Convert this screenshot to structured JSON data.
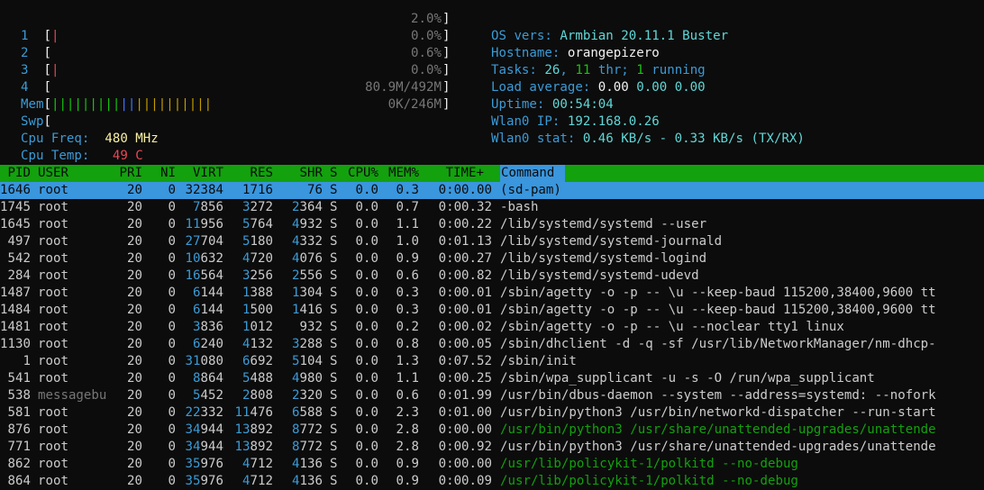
{
  "meters": {
    "cpus": [
      {
        "label": "1",
        "value": "2.0%"
      },
      {
        "label": "2",
        "value": "0.0%"
      },
      {
        "label": "3",
        "value": "0.6%"
      },
      {
        "label": "4",
        "value": "0.0%"
      }
    ],
    "mem": {
      "label": "Mem",
      "value": "80.9M/492M"
    },
    "swp": {
      "label": "Swp",
      "value": "0K/246M"
    },
    "cpu_freq": {
      "label": "Cpu Freq:",
      "value": "480 MHz"
    },
    "cpu_temp": {
      "label": "Cpu Temp:",
      "value": "49 C"
    }
  },
  "sysinfo": {
    "os_label": "OS vers:",
    "os_value": "Armbian 20.11.1 Buster",
    "host_label": "Hostname:",
    "host_value": "orangepizero",
    "tasks_label": "Tasks:",
    "tasks_count": "26",
    "tasks_sep1": ", ",
    "tasks_thr": "11",
    "tasks_thr_label": " thr; ",
    "tasks_running": "1",
    "tasks_running_label": " running",
    "load_label": "Load average:",
    "load1": "0.00",
    "load5": "0.00",
    "load15": "0.00",
    "uptime_label": "Uptime:",
    "uptime_value": "00:54:04",
    "ip_label": "Wlan0 IP:",
    "ip_value": "192.168.0.26",
    "stat_label": "Wlan0 stat:",
    "stat_value": "0.46 KB/s - 0.33 KB/s (TX/RX)"
  },
  "columns": [
    "PID",
    "USER",
    "PRI",
    "NI",
    "VIRT",
    "RES",
    "SHR",
    "S",
    "CPU%",
    "MEM%",
    "TIME+",
    "Command"
  ],
  "processes": [
    {
      "pid": "1646",
      "user": "root",
      "pri": "20",
      "ni": "0",
      "virt": "32384",
      "res": "1716",
      "shr": "76",
      "s": "S",
      "cpu": "0.0",
      "mem": "0.3",
      "time": "0:00.00",
      "cmd": "(sd-pam)"
    },
    {
      "pid": "1745",
      "user": "root",
      "pri": "20",
      "ni": "0",
      "virt": "7856",
      "res": "3272",
      "shr": "2364",
      "s": "S",
      "cpu": "0.0",
      "mem": "0.7",
      "time": "0:00.32",
      "cmd": "-bash"
    },
    {
      "pid": "1645",
      "user": "root",
      "pri": "20",
      "ni": "0",
      "virt": "11956",
      "res": "5764",
      "shr": "4932",
      "s": "S",
      "cpu": "0.0",
      "mem": "1.1",
      "time": "0:00.22",
      "cmd": "/lib/systemd/systemd --user"
    },
    {
      "pid": "497",
      "user": "root",
      "pri": "20",
      "ni": "0",
      "virt": "27704",
      "res": "5180",
      "shr": "4332",
      "s": "S",
      "cpu": "0.0",
      "mem": "1.0",
      "time": "0:01.13",
      "cmd": "/lib/systemd/systemd-journald"
    },
    {
      "pid": "542",
      "user": "root",
      "pri": "20",
      "ni": "0",
      "virt": "10632",
      "res": "4720",
      "shr": "4076",
      "s": "S",
      "cpu": "0.0",
      "mem": "0.9",
      "time": "0:00.27",
      "cmd": "/lib/systemd/systemd-logind"
    },
    {
      "pid": "284",
      "user": "root",
      "pri": "20",
      "ni": "0",
      "virt": "16564",
      "res": "3256",
      "shr": "2556",
      "s": "S",
      "cpu": "0.0",
      "mem": "0.6",
      "time": "0:00.82",
      "cmd": "/lib/systemd/systemd-udevd"
    },
    {
      "pid": "1487",
      "user": "root",
      "pri": "20",
      "ni": "0",
      "virt": "6144",
      "res": "1388",
      "shr": "1304",
      "s": "S",
      "cpu": "0.0",
      "mem": "0.3",
      "time": "0:00.01",
      "cmd": "/sbin/agetty -o -p -- \\u --keep-baud 115200,38400,9600 tt"
    },
    {
      "pid": "1484",
      "user": "root",
      "pri": "20",
      "ni": "0",
      "virt": "6144",
      "res": "1500",
      "shr": "1416",
      "s": "S",
      "cpu": "0.0",
      "mem": "0.3",
      "time": "0:00.01",
      "cmd": "/sbin/agetty -o -p -- \\u --keep-baud 115200,38400,9600 tt"
    },
    {
      "pid": "1481",
      "user": "root",
      "pri": "20",
      "ni": "0",
      "virt": "3836",
      "res": "1012",
      "shr": "932",
      "s": "S",
      "cpu": "0.0",
      "mem": "0.2",
      "time": "0:00.02",
      "cmd": "/sbin/agetty -o -p -- \\u --noclear tty1 linux"
    },
    {
      "pid": "1130",
      "user": "root",
      "pri": "20",
      "ni": "0",
      "virt": "6240",
      "res": "4132",
      "shr": "3288",
      "s": "S",
      "cpu": "0.0",
      "mem": "0.8",
      "time": "0:00.05",
      "cmd": "/sbin/dhclient -d -q -sf /usr/lib/NetworkManager/nm-dhcp-"
    },
    {
      "pid": "1",
      "user": "root",
      "pri": "20",
      "ni": "0",
      "virt": "31080",
      "res": "6692",
      "shr": "5104",
      "s": "S",
      "cpu": "0.0",
      "mem": "1.3",
      "time": "0:07.52",
      "cmd": "/sbin/init"
    },
    {
      "pid": "541",
      "user": "root",
      "pri": "20",
      "ni": "0",
      "virt": "8864",
      "res": "5488",
      "shr": "4980",
      "s": "S",
      "cpu": "0.0",
      "mem": "1.1",
      "time": "0:00.25",
      "cmd": "/sbin/wpa_supplicant -u -s -O /run/wpa_supplicant"
    },
    {
      "pid": "538",
      "user": "messagebu",
      "pri": "20",
      "ni": "0",
      "virt": "5452",
      "res": "2808",
      "shr": "2320",
      "s": "S",
      "cpu": "0.0",
      "mem": "0.6",
      "time": "0:01.99",
      "cmd": "/usr/bin/dbus-daemon --system --address=systemd: --nofork"
    },
    {
      "pid": "581",
      "user": "root",
      "pri": "20",
      "ni": "0",
      "virt": "22332",
      "res": "11476",
      "shr": "6588",
      "s": "S",
      "cpu": "0.0",
      "mem": "2.3",
      "time": "0:01.00",
      "cmd": "/usr/bin/python3 /usr/bin/networkd-dispatcher --run-start"
    },
    {
      "pid": "876",
      "user": "root",
      "pri": "20",
      "ni": "0",
      "virt": "34944",
      "res": "13892",
      "shr": "8772",
      "s": "S",
      "cpu": "0.0",
      "mem": "2.8",
      "time": "0:00.00",
      "cmd": "/usr/bin/python3 /usr/share/unattended-upgrades/unattende",
      "thread": true
    },
    {
      "pid": "771",
      "user": "root",
      "pri": "20",
      "ni": "0",
      "virt": "34944",
      "res": "13892",
      "shr": "8772",
      "s": "S",
      "cpu": "0.0",
      "mem": "2.8",
      "time": "0:00.92",
      "cmd": "/usr/bin/python3 /usr/share/unattended-upgrades/unattende"
    },
    {
      "pid": "862",
      "user": "root",
      "pri": "20",
      "ni": "0",
      "virt": "35976",
      "res": "4712",
      "shr": "4136",
      "s": "S",
      "cpu": "0.0",
      "mem": "0.9",
      "time": "0:00.00",
      "cmd": "/usr/lib/policykit-1/polkitd --no-debug",
      "thread": true
    },
    {
      "pid": "864",
      "user": "root",
      "pri": "20",
      "ni": "0",
      "virt": "35976",
      "res": "4712",
      "shr": "4136",
      "s": "S",
      "cpu": "0.0",
      "mem": "0.9",
      "time": "0:00.09",
      "cmd": "/usr/lib/policykit-1/polkitd --no-debug",
      "thread": true
    }
  ],
  "colors": {
    "header_bg": "#13a10e",
    "selected_bg": "#3a96dd",
    "command_header_bg": "#3a96dd"
  }
}
